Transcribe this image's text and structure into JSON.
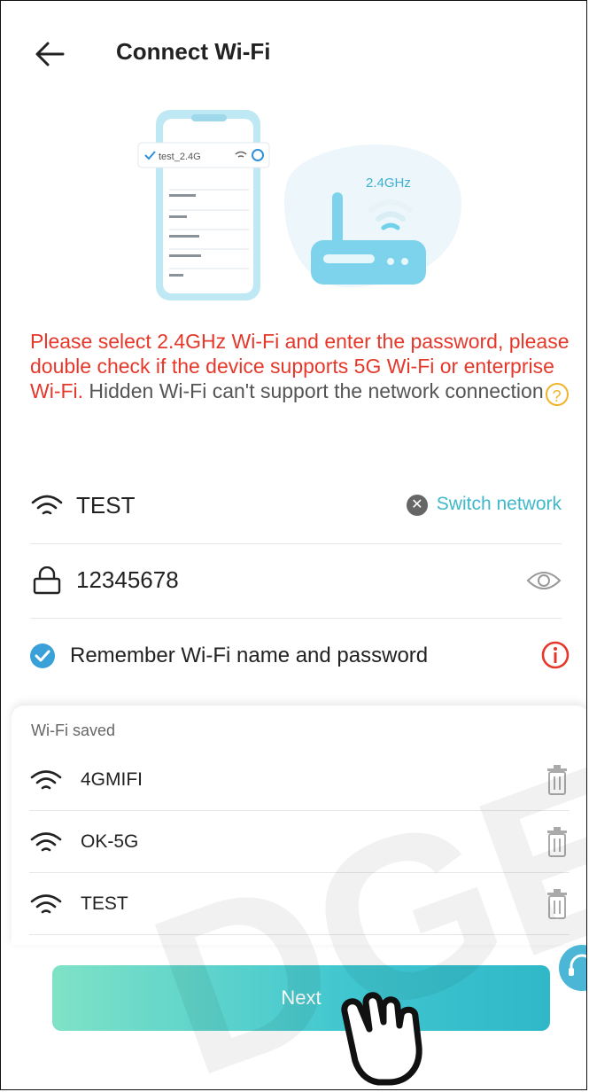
{
  "header": {
    "title": "Connect Wi-Fi"
  },
  "illustration": {
    "phone_network": "test_2.4G",
    "band_label": "2.4GHz"
  },
  "notice": {
    "red_text": "Please select 2.4GHz Wi-Fi and enter the password, please double check if the device supports 5G Wi-Fi or enterprise Wi-Fi.",
    "gray_text": " Hidden Wi-Fi can't support the network connection"
  },
  "network": {
    "name": "TEST",
    "switch_label": "Switch network"
  },
  "password": {
    "value": "12345678"
  },
  "remember": {
    "label": "Remember Wi-Fi name and password"
  },
  "saved": {
    "caption": "Wi-Fi saved",
    "items": [
      {
        "name": "4GMIFI"
      },
      {
        "name": "OK-5G"
      },
      {
        "name": "TEST"
      }
    ]
  },
  "next_button": {
    "label": "Next"
  },
  "watermark": {
    "text": "DGET"
  },
  "colors": {
    "accent": "#3fb8c9",
    "warning": "#e5382b",
    "check": "#3aa0d8"
  }
}
